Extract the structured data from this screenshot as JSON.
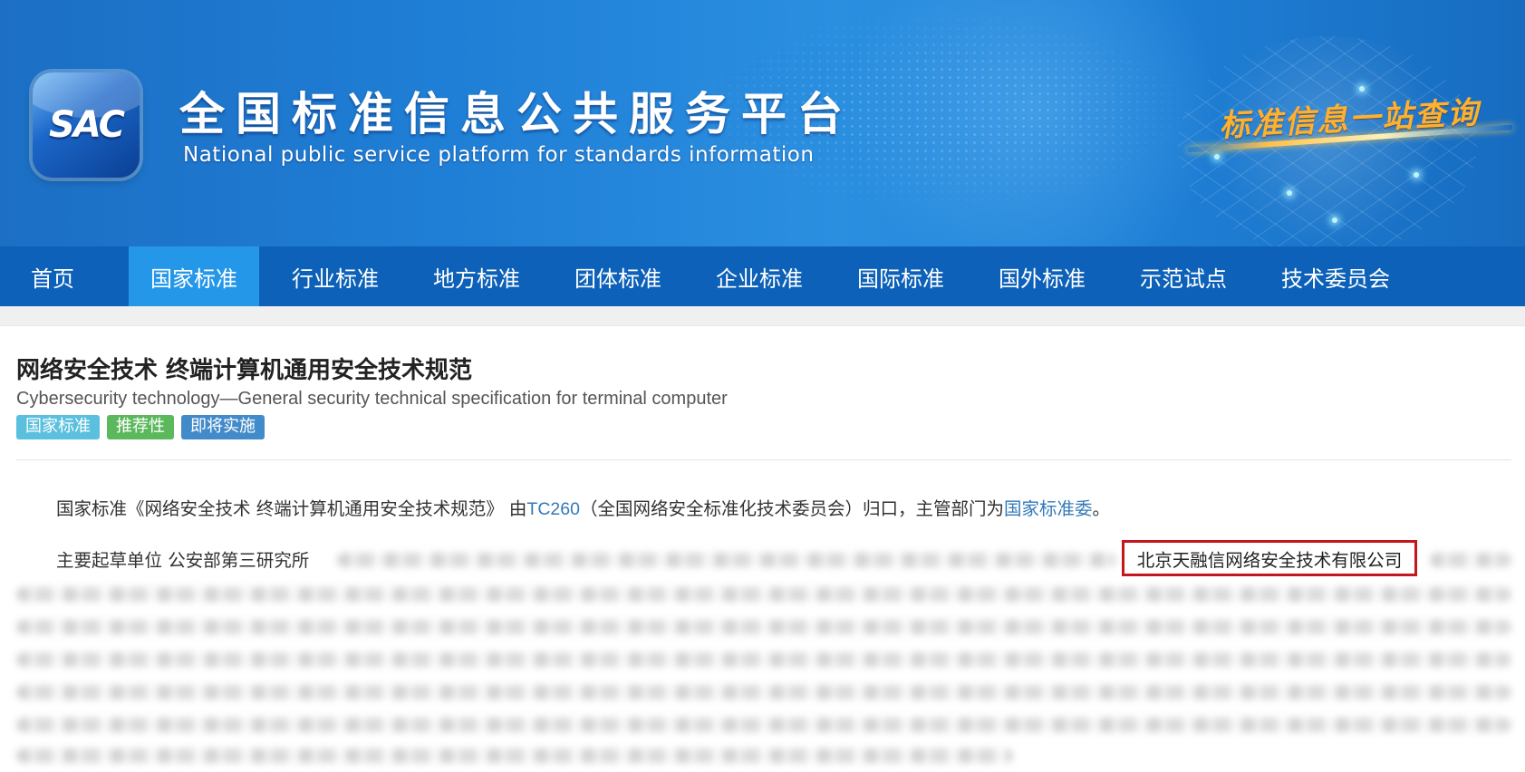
{
  "header": {
    "logo_text": "SAC",
    "site_title": "全国标准信息公共服务平台",
    "site_subtitle": "National public service platform  for standards information",
    "slogan": "标准信息一站查询"
  },
  "nav": {
    "items": [
      {
        "label": "首页",
        "active": false
      },
      {
        "label": "国家标准",
        "active": true
      },
      {
        "label": "行业标准",
        "active": false
      },
      {
        "label": "地方标准",
        "active": false
      },
      {
        "label": "团体标准",
        "active": false
      },
      {
        "label": "企业标准",
        "active": false
      },
      {
        "label": "国际标准",
        "active": false
      },
      {
        "label": "国外标准",
        "active": false
      },
      {
        "label": "示范试点",
        "active": false
      },
      {
        "label": "技术委员会",
        "active": false
      }
    ]
  },
  "standard": {
    "title_cn": "网络安全技术 终端计算机通用安全技术规范",
    "title_en": "Cybersecurity technology—General security technical specification for terminal computer",
    "tags": [
      {
        "label": "国家标准",
        "color": "#5bc0de"
      },
      {
        "label": "推荐性",
        "color": "#5cb85c"
      },
      {
        "label": "即将实施",
        "color": "#428bca"
      }
    ],
    "summary": {
      "prefix": "国家标准《网络安全技术 终端计算机通用安全技术规范》 由",
      "tc_link": "TC260",
      "middle": "（全国网络安全标准化技术委员会）归口，主管部门为",
      "dept_link": "国家标准委",
      "suffix": "。"
    },
    "drafters": {
      "label": "主要起草单位 公安部第三研究所",
      "highlighted": "北京天融信网络安全技术有限公司"
    }
  },
  "colors": {
    "nav_bg": "#0d61b8",
    "nav_active": "#2597e9",
    "link": "#337ab7",
    "highlight_border": "#c4161c"
  }
}
